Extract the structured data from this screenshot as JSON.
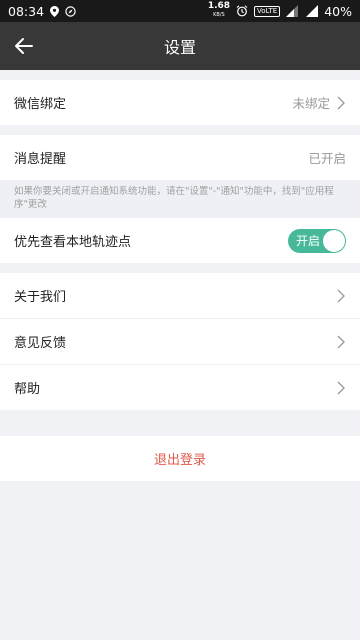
{
  "statusbar": {
    "time": "08:34",
    "speed_value": "1.68",
    "speed_unit": "KB/S",
    "volte": "VoLTE",
    "network": "4G",
    "battery": "40%"
  },
  "appbar": {
    "title": "设置"
  },
  "wechat": {
    "label": "微信绑定",
    "value": "未绑定"
  },
  "notify": {
    "label": "消息提醒",
    "value": "已开启",
    "hint": "如果你要关闭或开启通知系统功能，请在\"设置\"-\"通知\"功能中，找到\"应用程序\"更改"
  },
  "local_track": {
    "label": "优先查看本地轨迹点",
    "toggle_text": "开启",
    "toggle_state": "on"
  },
  "menu": [
    {
      "label": "关于我们"
    },
    {
      "label": "意见反馈"
    },
    {
      "label": "帮助"
    }
  ],
  "logout": {
    "label": "退出登录"
  },
  "colors": {
    "accent": "#47b99a",
    "danger": "#e05a4b",
    "appbar": "#383838"
  }
}
